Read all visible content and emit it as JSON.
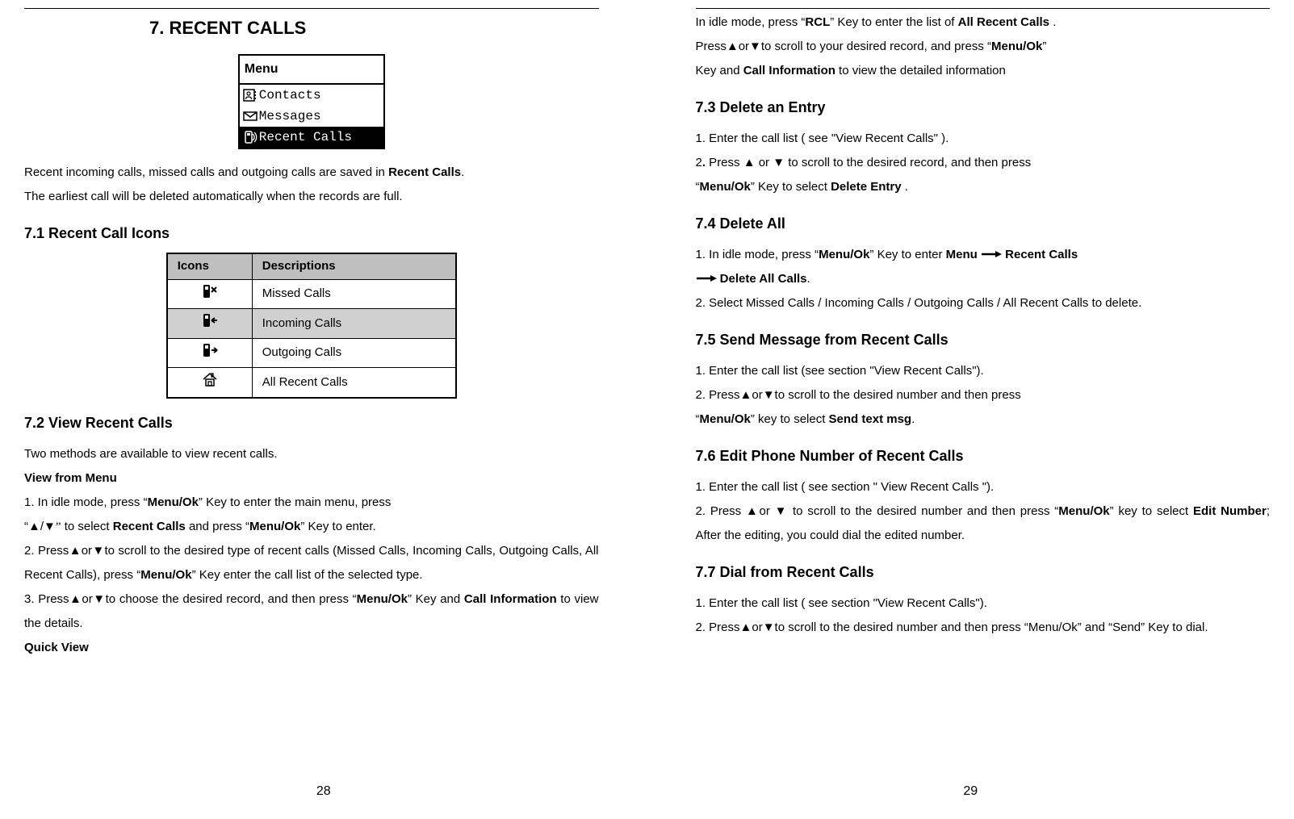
{
  "left": {
    "chapterTitle": "7. RECENT CALLS",
    "lcd": {
      "title": "Menu",
      "items": [
        {
          "icon": "contacts-icon",
          "label": "Contacts"
        },
        {
          "icon": "messages-icon",
          "label": "Messages"
        },
        {
          "icon": "recent-icon",
          "label": "Recent Calls"
        }
      ]
    },
    "intro1a": "Recent incoming calls, missed calls and outgoing calls are saved in ",
    "intro1b": "Recent Calls",
    "intro1c": ".",
    "intro2": "The earliest call will be deleted automatically when the records are full.",
    "s71": {
      "title": "7.1 Recent Call Icons",
      "tableHeadIcons": "Icons",
      "tableHeadDesc": "Descriptions",
      "rows": [
        {
          "icon": "phone-missed-icon",
          "desc": "Missed Calls"
        },
        {
          "icon": "phone-incoming-icon",
          "desc": "Incoming Calls"
        },
        {
          "icon": "phone-outgoing-icon",
          "desc": "Outgoing Calls"
        },
        {
          "icon": "home-icon",
          "desc": "All Recent Calls"
        }
      ]
    },
    "s72": {
      "title": "7.2 View Recent Calls",
      "line1": "Two methods are available to view recent calls.",
      "sub1": "View from Menu",
      "p1a": "1. In idle mode, press “",
      "p1b": "Menu/Ok",
      "p1c": "” Key  to enter the main menu, press",
      "p2a": "“▲/▼",
      "p2b": "”",
      "p2c": " to select ",
      "p2d": "Recent Calls",
      "p2e": " and press “",
      "p2f": "Menu/Ok",
      "p2g": "” Key  to enter.",
      "p3a": "2. Press▲or▼to scroll to the desired type of recent calls (Missed Calls, Incoming Calls, Outgoing Calls, All Recent Calls), press “",
      "p3b": "Menu/Ok",
      "p3c": "” Key enter the call list of the selected type.",
      "p4a": "3. Press▲or▼to choose the desired record, and then press “",
      "p4b": "Menu/Ok",
      "p4c": "” Key and ",
      "p4d": "Call Information",
      "p4e": " to view the details.",
      "sub2": "Quick View"
    },
    "pageNum": "28"
  },
  "right": {
    "qv1a": "In idle mode, press “",
    "qv1b": "RCL",
    "qv1c": "” Key  to enter the list of ",
    "qv1d": "All Recent Calls",
    "qv1e": " .",
    "qv2a": "Press▲or▼to scroll to your desired record, and press “",
    "qv2b": "Menu/Ok",
    "qv2c": "”",
    "qv3a": "Key and ",
    "qv3b": "Call Information",
    "qv3c": " to view the detailed information",
    "s73": {
      "title": "7.3 Delete an Entry",
      "p1": "1. Enter the call list ( see \"View Recent Calls\" ).",
      "p2a": "2",
      "p2b": ".",
      "p2c": " Press ▲ or ▼ to scroll to the desired record, and then press",
      "p3a": " “",
      "p3b": "Menu/Ok",
      "p3c": "” Key to select ",
      "p3d": "Delete Entry",
      "p3e": " ."
    },
    "s74": {
      "title": "7.4 Delete All",
      "p1a": "1. In idle mode, press “",
      "p1b": "Menu/Ok",
      "p1c": "” Key to enter ",
      "p1d": "Menu",
      "p1e": " ",
      "p1f": "Recent Calls",
      "p2a": " ",
      "p2b": "Delete All Calls",
      "p2c": ".",
      "p3": "2. Select Missed Calls / Incoming Calls / Outgoing Calls / All Recent Calls to delete."
    },
    "s75": {
      "title": "7.5 Send Message from Recent Calls",
      "p1": "1. Enter the call list (see section \"View Recent Calls\").",
      "p2": "2. Press▲or▼to scroll to the desired number and then press",
      "p3a": " “",
      "p3b": "Menu/Ok",
      "p3c": "” key to select ",
      "p3d": "Send text msg",
      "p3e": "."
    },
    "s76": {
      "title": "7.6 Edit Phone Number of Recent Calls",
      "p1": "1. Enter the call list ( see section \" View Recent Calls \").",
      "p2a": "2. Press ▲or ▼ to scroll to the desired number and then press “",
      "p2b": "Menu/Ok",
      "p2c": "” key to select ",
      "p2d": "Edit Number",
      "p2e": "; After the editing, you could dial the edited number."
    },
    "s77": {
      "title": "7.7 Dial from Recent Calls",
      "p1": "1. Enter the call list ( see section \"View Recent Calls\").",
      "p2": "2. Press▲or▼to scroll to the desired number and then press “Menu/Ok” and “Send” Key to dial."
    },
    "pageNum": "29"
  }
}
